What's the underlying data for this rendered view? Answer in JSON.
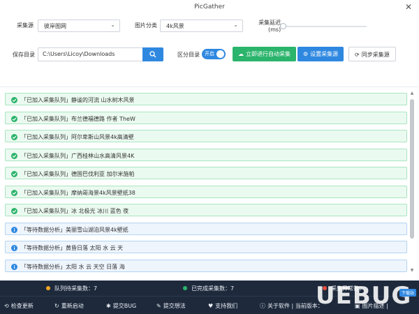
{
  "window": {
    "title": "PicGather",
    "close_glyph": "✕"
  },
  "form": {
    "source_label": "采集源",
    "source_value": "彼岸图网",
    "category_label": "图片分类",
    "category_value": "4k风景",
    "delay_label_line1": "采集延迟",
    "delay_label_line2": "(ms)",
    "save_dir_label": "保存目录",
    "save_dir_value": "C:\\Users\\Licoy\\Downloads",
    "split_dir_label": "区分目录",
    "toggle_on_label": "开启"
  },
  "buttons": {
    "auto_collect": "立即进行自动采集",
    "set_source": "设置采集源",
    "sync_source": "同步采集源"
  },
  "queue": [
    {
      "status": "done",
      "text": "「已加入采集队列」静谧的河流 山水树木风景"
    },
    {
      "status": "done",
      "text": "「已加入采集队列」布兰德福德路 作者 TheW"
    },
    {
      "status": "done",
      "text": "「已加入采集队列」阿尔卑斯山风景4k高清壁"
    },
    {
      "status": "done",
      "text": "「已加入采集队列」广西桂林山水高清风景4K"
    },
    {
      "status": "done",
      "text": "「已加入采集队列」德国巴伐利亚 加尔米施帕"
    },
    {
      "status": "done",
      "text": "「已加入采集队列」摩纳哥海景4k风景壁纸38"
    },
    {
      "status": "done",
      "text": "「已加入采集队列」冰 北极光 冰川 蓝色 夜"
    },
    {
      "status": "wait",
      "text": "「等待数据分析」美丽雪山湖泊风景4k壁纸"
    },
    {
      "status": "wait",
      "text": "「等待数据分析」黄昏日落 太阳 水 云 天"
    },
    {
      "status": "wait",
      "text": "「等待数据分析」太阳 水 云 天空 日落 海"
    }
  ],
  "status": {
    "pending_label": "队列待采集数：7",
    "completed_label": "已完成采集数：7",
    "error_label": "采集异常数：",
    "pending_color": "#f5a623",
    "completed_color": "#2bb46b",
    "error_color": "#e84c3d"
  },
  "bottom": {
    "check_update": "检查更新",
    "restart": "重新启动",
    "submit_bug": "提交BUG",
    "submit_idea": "提交想法",
    "support": "支持我们",
    "about": "关于软件 | 当前版本：",
    "extra": "图片描述 |"
  },
  "watermark": {
    "text": "UEBUG",
    "badge": "下载站"
  }
}
